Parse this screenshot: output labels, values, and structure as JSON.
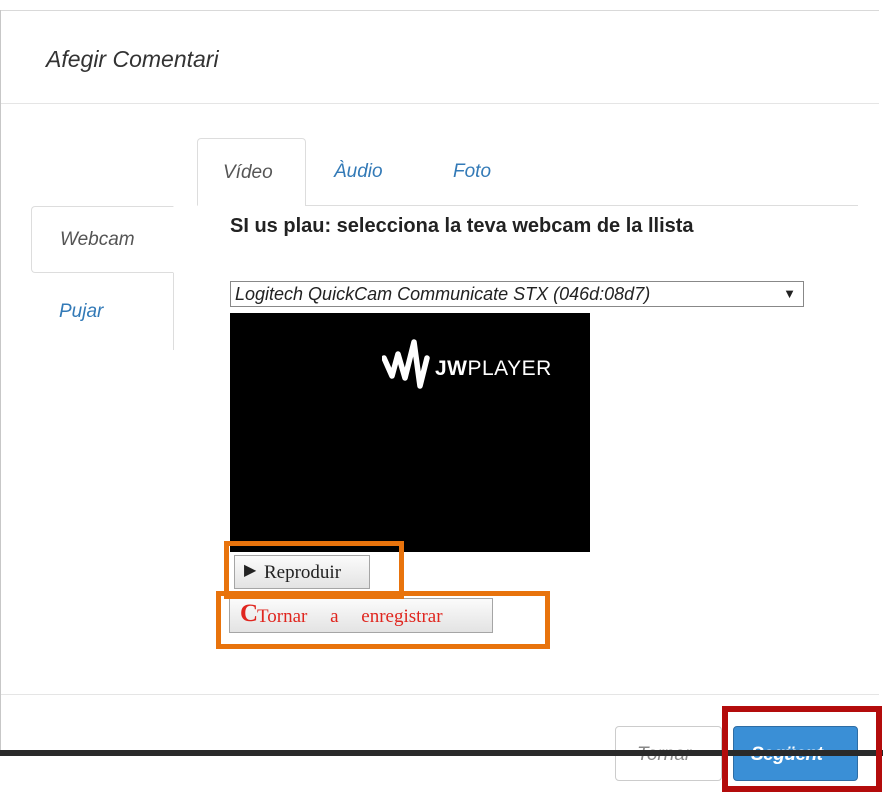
{
  "modal": {
    "title": "Afegir Comentari"
  },
  "side_tabs": [
    {
      "label": "Webcam",
      "active": true
    },
    {
      "label": "Pujar",
      "active": false
    }
  ],
  "media_tabs": [
    {
      "label": "Vídeo",
      "active": true
    },
    {
      "label": "Àudio",
      "active": false
    },
    {
      "label": "Foto",
      "active": false
    }
  ],
  "webcam": {
    "instruction": "SI us plau: selecciona la teva webcam de la llista",
    "selected_device": "Logitech QuickCam Communicate STX (046d:08d7)"
  },
  "player": {
    "brand_bold": "JW",
    "brand_light": "PLAYER"
  },
  "controls": {
    "play_label": "Reproduir",
    "rerecord_label": "Tornar a enregistrar"
  },
  "footer": {
    "back_label": "Tornar",
    "next_label": "Següent"
  },
  "colors": {
    "link": "#337ab7",
    "primary_button": "#3a8fd6",
    "highlight_orange": "#e8730c",
    "highlight_red": "#b30c0c",
    "rerecord_text": "#e0261f"
  },
  "icons": {
    "play": "play-triangle-icon",
    "rerecord": "refresh-icon",
    "dropdown": "caret-down-icon"
  }
}
